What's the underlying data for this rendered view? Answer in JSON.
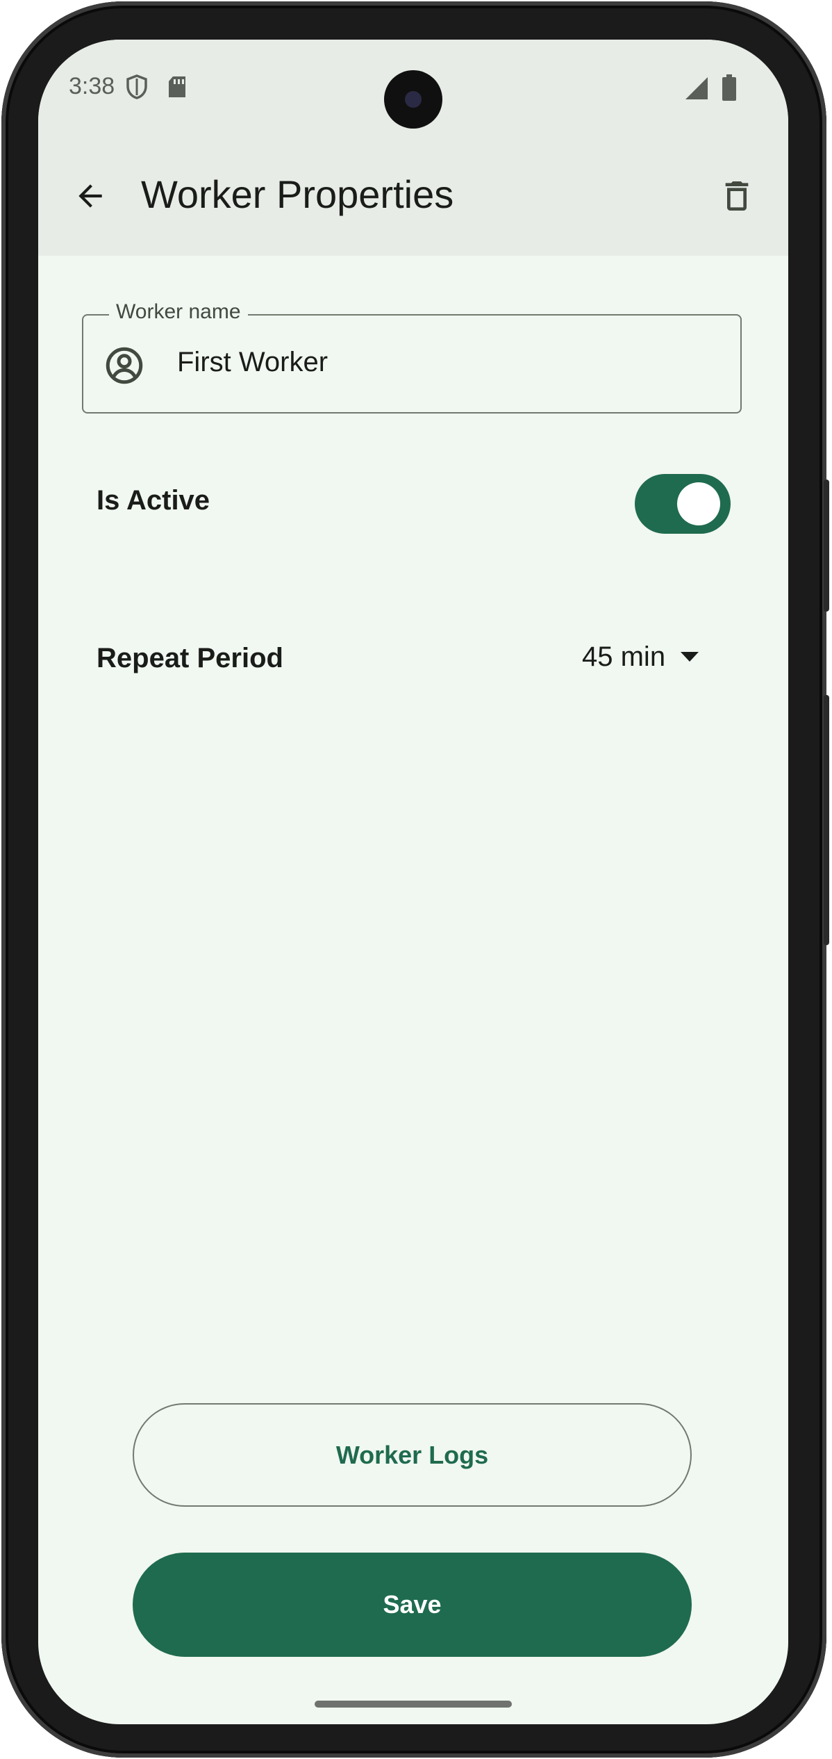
{
  "status_bar": {
    "time": "3:38",
    "left_icons": [
      "shield-icon",
      "sd-card-icon"
    ],
    "right_icons": [
      "signal-icon",
      "battery-icon"
    ]
  },
  "app_bar": {
    "title": "Worker Properties",
    "back_icon": "arrow-back-icon",
    "delete_icon": "trash-icon"
  },
  "worker_name_field": {
    "label": "Worker name",
    "value": "First Worker",
    "icon": "account-circle-icon"
  },
  "is_active": {
    "label": "Is Active",
    "checked": true
  },
  "repeat_period": {
    "label": "Repeat Period",
    "selected": "45 min",
    "icon": "dropdown-arrow-icon"
  },
  "buttons": {
    "logs_label": "Worker Logs",
    "save_label": "Save"
  },
  "colors": {
    "primary": "#1f6b4f",
    "background": "#f1f7f1",
    "top_bar": "#e7ece6",
    "outline": "#72796f"
  }
}
